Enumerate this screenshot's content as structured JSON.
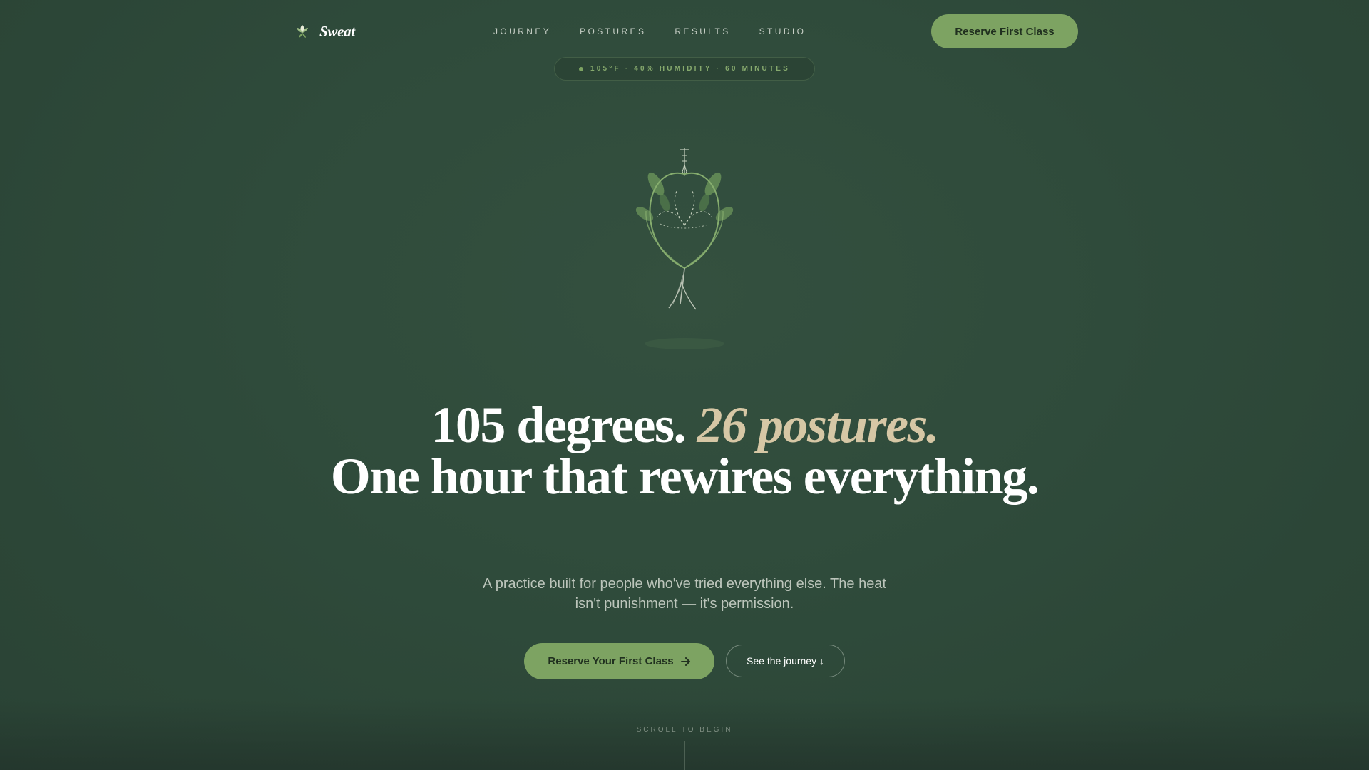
{
  "brand": {
    "name": "Sweat",
    "logo_icon": "lotus-leaf-icon"
  },
  "nav": {
    "items": [
      {
        "label": "JOURNEY"
      },
      {
        "label": "POSTURES"
      },
      {
        "label": "RESULTS"
      },
      {
        "label": "STUDIO"
      }
    ]
  },
  "header": {
    "cta_label": "Reserve First Class"
  },
  "pill": {
    "text": "105°F · 40% HUMIDITY · 60 MINUTES"
  },
  "hero": {
    "illustration_icon": "botanical-lotus-illustration",
    "headline_part1": "105 degrees. ",
    "headline_accent": "26 postures.",
    "headline_part2": "One hour that rewires everything.",
    "subtext": "A practice built for people who've tried everything else. The heat isn't punishment — it's permission.",
    "cta_primary_label": "Reserve Your First Class",
    "cta_primary_icon": "arrow-right-icon",
    "cta_secondary_label": "See the journey ↓"
  },
  "scroll": {
    "label": "SCROLL TO BEGIN"
  },
  "colors": {
    "background": "#2f4b3b",
    "accent_green": "#7da362",
    "accent_sand": "#d6c7a5",
    "text_muted": "#bcc5bb"
  }
}
